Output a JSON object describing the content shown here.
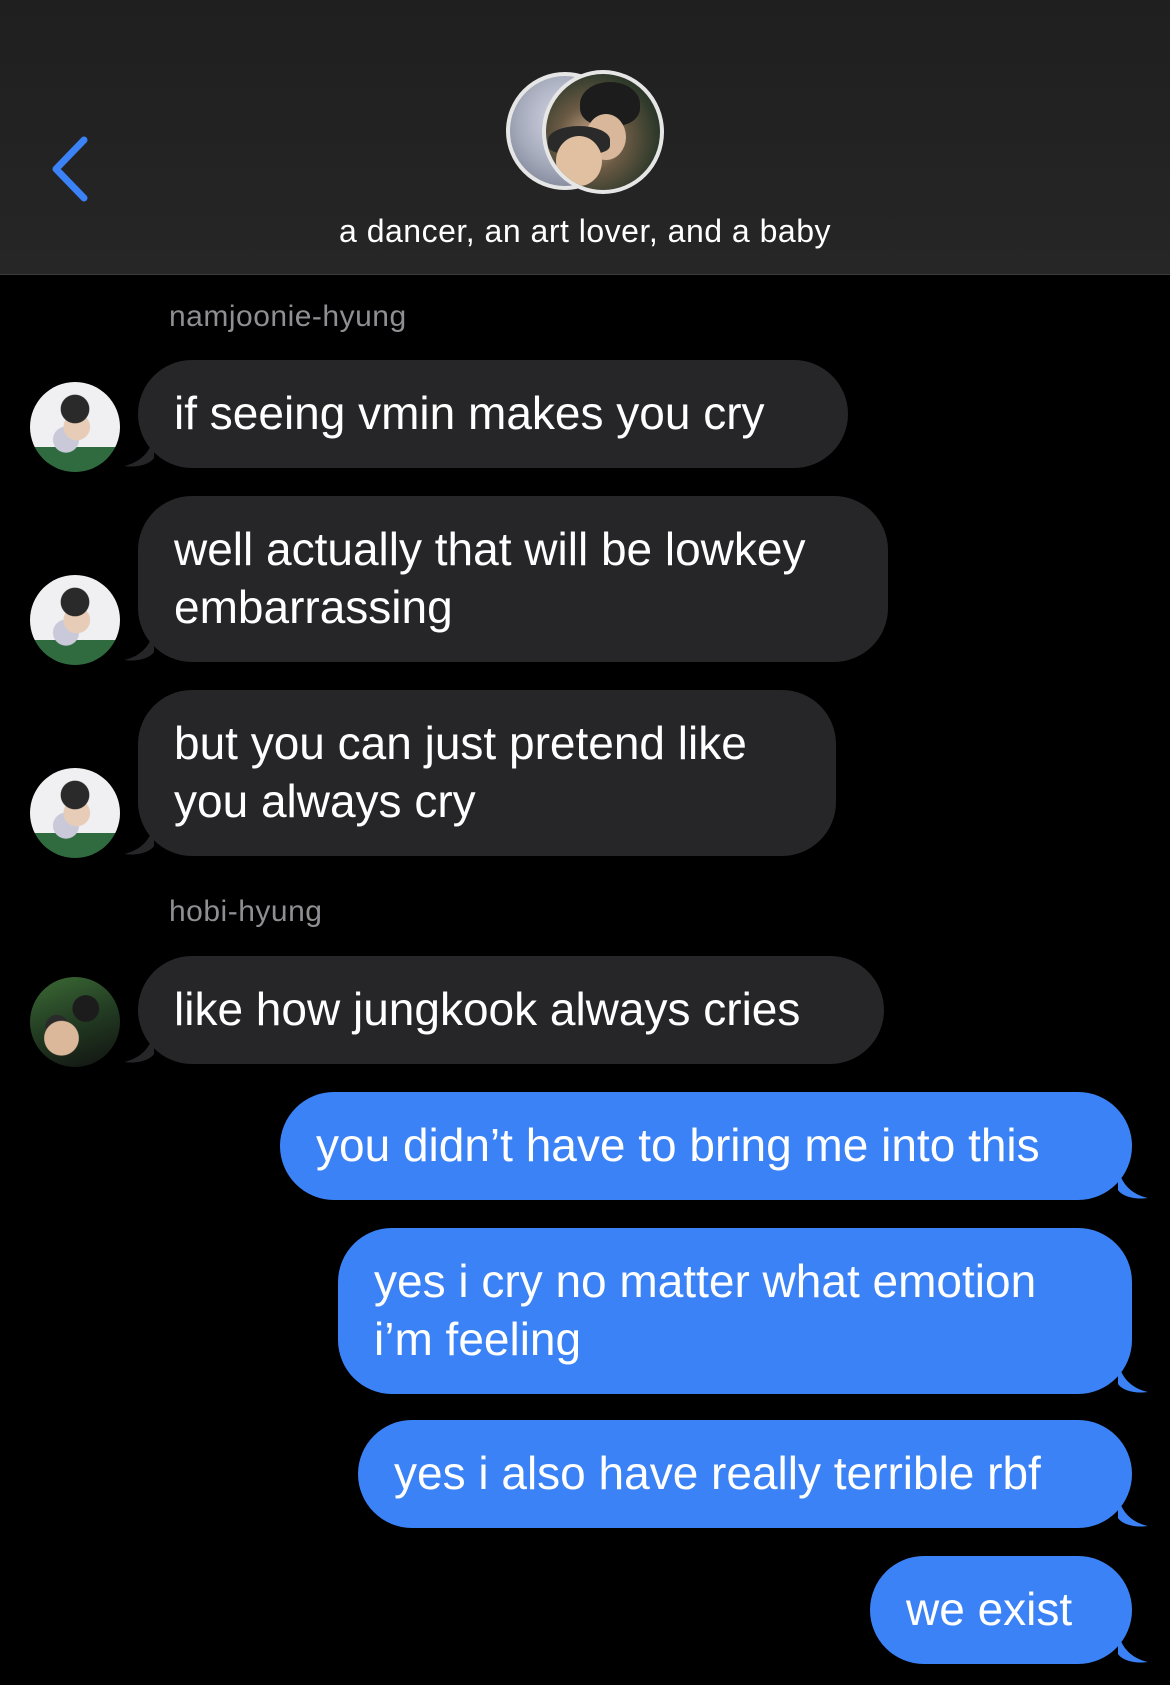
{
  "header": {
    "title": "a dancer, an art lover, and a baby",
    "back_icon": "chevron-left-icon",
    "avatar": "group-avatar"
  },
  "colors": {
    "incoming_bubble": "#262628",
    "outgoing_bubble": "#3b82f6",
    "accent": "#3b82f6",
    "sender_label": "#8e8e93",
    "background": "#000000"
  },
  "conversation": {
    "senders": {
      "namjoon": "namjoonie-hyung",
      "hobi": "hobi-hyung"
    },
    "messages": [
      {
        "direction": "incoming",
        "sender": "namjoonie-hyung",
        "text": "if seeing vmin makes you cry"
      },
      {
        "direction": "incoming",
        "sender": "namjoonie-hyung",
        "text": "well actually that will be lowkey\nembarrassing"
      },
      {
        "direction": "incoming",
        "sender": "namjoonie-hyung",
        "text": "but you can just pretend like\nyou always cry"
      },
      {
        "direction": "incoming",
        "sender": "hobi-hyung",
        "text": "like how jungkook always cries"
      },
      {
        "direction": "outgoing",
        "text": "you didn’t have to bring me into this"
      },
      {
        "direction": "outgoing",
        "text": "yes i cry no matter what emotion\ni’m feeling"
      },
      {
        "direction": "outgoing",
        "text": "yes i also have really terrible rbf"
      },
      {
        "direction": "outgoing",
        "text": "we exist"
      }
    ]
  }
}
